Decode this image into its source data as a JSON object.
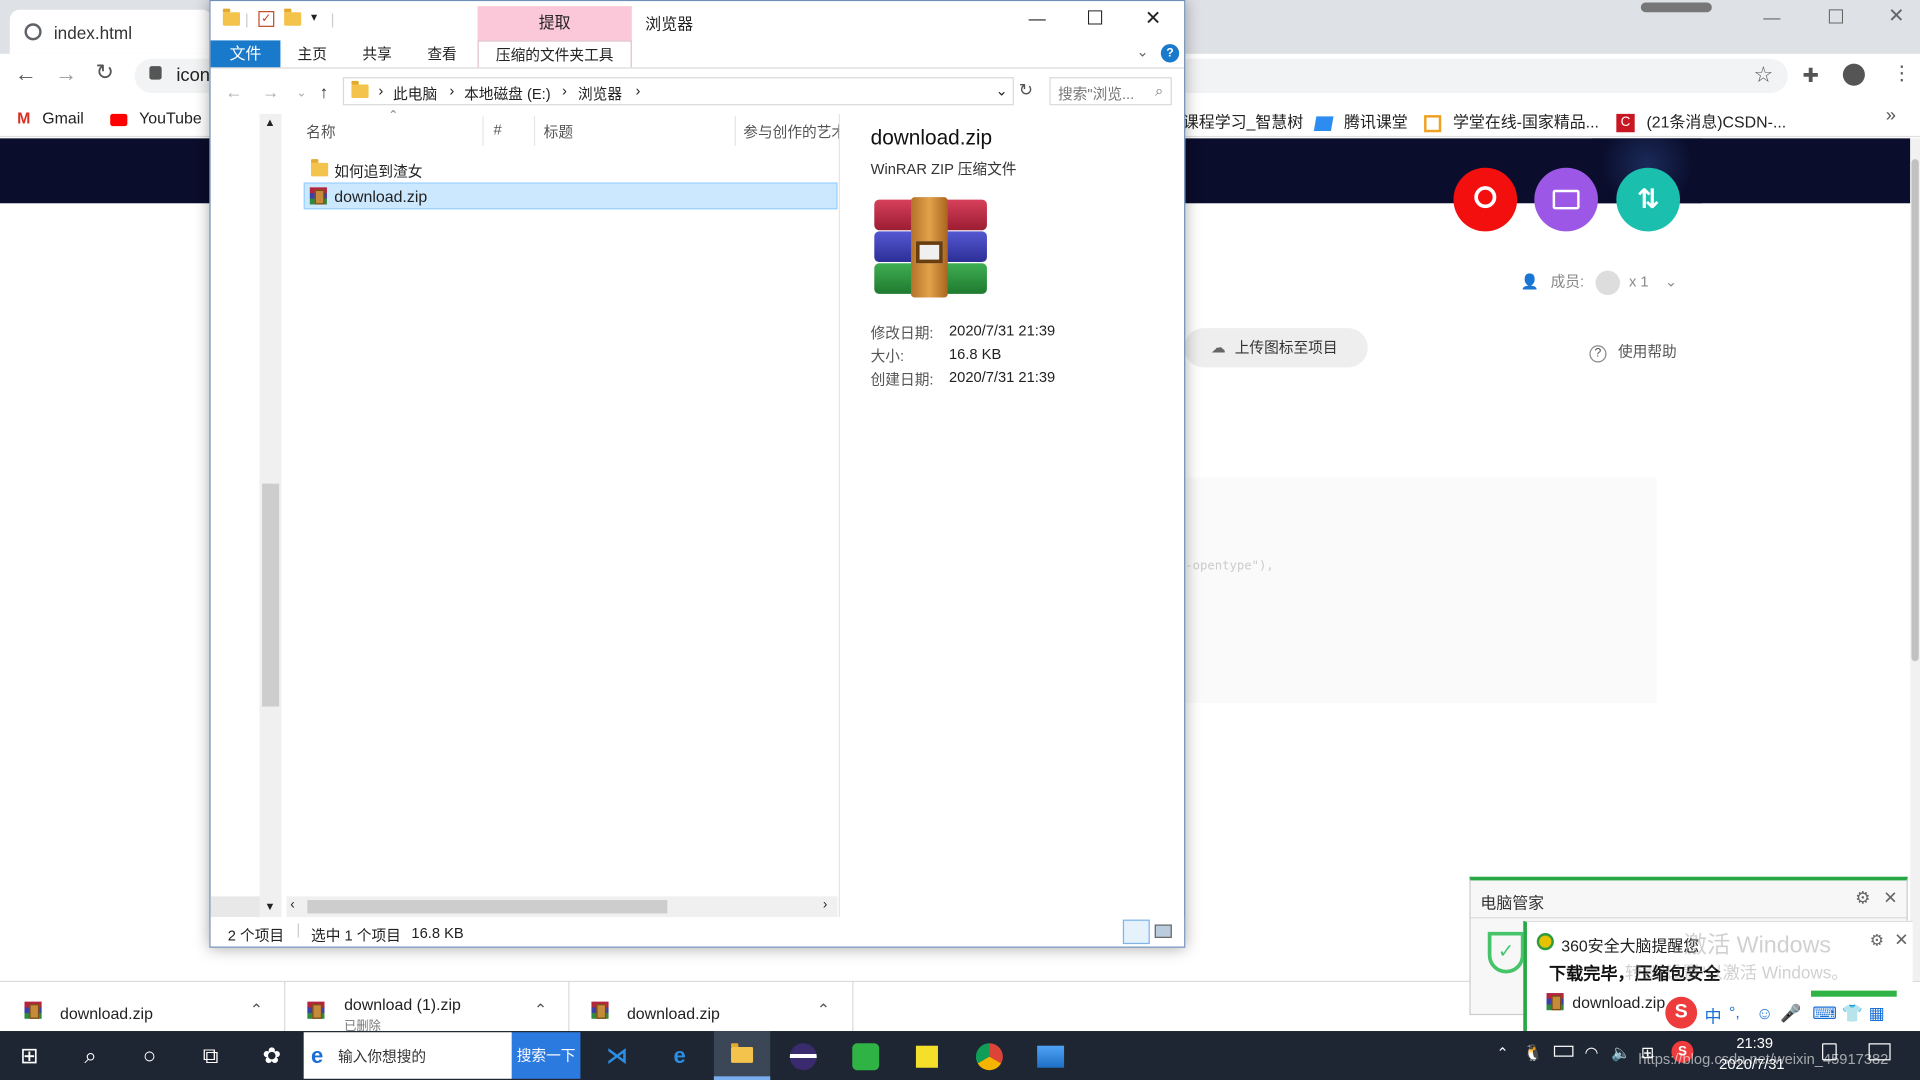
{
  "browser": {
    "tab_title": "index.html",
    "address_partial": "icon",
    "bookmarks": [
      "Gmail",
      "YouTube",
      "课程学习_智慧树",
      "腾讯课堂",
      "学堂在线-国家精品...",
      "(21条消息)CSDN-..."
    ],
    "more": "»"
  },
  "site": {
    "members_label": "成员:",
    "members_count": "x 1",
    "upload_label": "上传图标至项目",
    "help_label": "使用帮助",
    "code_snippet": "-opentype\"),",
    "colors": {
      "search": "#f40f0f",
      "folder": "#9c57e6",
      "transfer": "#1bbfad",
      "header": "#0a0d2b"
    }
  },
  "explorer": {
    "title": "浏览器",
    "context_tab": "提取",
    "ribbon_tabs": [
      "文件",
      "主页",
      "共享",
      "查看",
      "压缩的文件夹工具"
    ],
    "breadcrumb": [
      "此电脑",
      "本地磁盘 (E:)",
      "浏览器"
    ],
    "search_placeholder": "搜索\"浏览...",
    "columns": [
      "名称",
      "#",
      "标题",
      "参与创作的艺术"
    ],
    "files": [
      {
        "name": "如何追到渣女",
        "type": "folder",
        "selected": false
      },
      {
        "name": "download.zip",
        "type": "zip",
        "selected": true
      }
    ],
    "preview": {
      "name": "download.zip",
      "type": "WinRAR ZIP 压缩文件",
      "fields": [
        {
          "label": "修改日期:",
          "value": "2020/7/31 21:39"
        },
        {
          "label": "大小:",
          "value": "16.8 KB"
        },
        {
          "label": "创建日期:",
          "value": "2020/7/31 21:39"
        }
      ]
    },
    "status": {
      "count": "2 个项目",
      "selection": "选中 1 个项目",
      "size": "16.8 KB"
    }
  },
  "downloads": [
    {
      "name": "download.zip",
      "sub": ""
    },
    {
      "name": "download (1).zip",
      "sub": "已删除"
    },
    {
      "name": "download.zip",
      "sub": ""
    }
  ],
  "notification": {
    "title": "电脑管家",
    "line1": "360安全大脑提醒您",
    "line2": "下载完毕，压缩包安全",
    "file": "download.zip",
    "watermark1": "激活 Windows",
    "watermark2": "转到\"设置\"以激活 Windows。"
  },
  "taskbar": {
    "search_placeholder": "输入你想搜的",
    "search_button": "搜索一下",
    "time": "21:39",
    "date": "2020/7/31",
    "ime": "中",
    "watermark_url": "https://blog.csdn.net/weixin_45917382"
  }
}
